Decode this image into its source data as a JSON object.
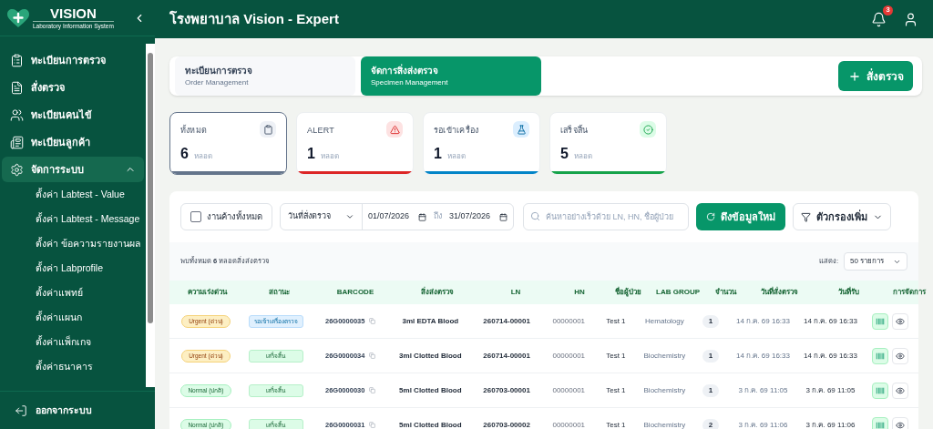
{
  "sidebar": {
    "logo": {
      "title": "VISION",
      "subtitle": "Laboratory Information System"
    },
    "items": [
      {
        "label": "ทะเบียนการตรวจ",
        "selected": false
      },
      {
        "label": "สั่งตรวจ",
        "selected": false
      },
      {
        "label": "ทะเบียนคนไข้",
        "selected": false
      },
      {
        "label": "ทะเบียนลูกค้า",
        "selected": false
      },
      {
        "label": "จัดการระบบ",
        "selected": true,
        "expanded": true,
        "children": [
          {
            "label": "ตั้งค่า Labtest - Value"
          },
          {
            "label": "ตั้งค่า Labtest - Message"
          },
          {
            "label": "ตั้งค่า ข้อความรายงานผล"
          },
          {
            "label": "ตั้งค่า Labprofile"
          },
          {
            "label": "ตั้งค่าแพทย์"
          },
          {
            "label": "ตั้งค่าแผนก"
          },
          {
            "label": "ตั้งค่าแพ็กเกจ"
          },
          {
            "label": "ตั้งค่าธนาคาร"
          }
        ]
      }
    ],
    "logout": "ออกจากระบบ"
  },
  "header": {
    "title": "โรงพยาบาล Vision - Expert",
    "notification_count": "3"
  },
  "tabs": [
    {
      "title": "ทะเบียนการตรวจ",
      "subtitle": "Order Management",
      "selected": false
    },
    {
      "title": "จัดการสิ่งส่งตรวจ",
      "subtitle": "Specimen Management",
      "selected": true
    }
  ],
  "new_order_button": "สั่งตรวจ",
  "stats": [
    {
      "label": "ทั้งหมด",
      "value": "6",
      "unit": "หลอด",
      "color": "#64748b",
      "selected": true
    },
    {
      "label": "ALERT",
      "value": "1",
      "unit": "หลอด",
      "color": "#dc2626",
      "selected": false
    },
    {
      "label": "รอเข้าเครื่อง",
      "value": "1",
      "unit": "หลอด",
      "color": "#0284c7",
      "selected": false
    },
    {
      "label": "เสร็จสิ้น",
      "value": "5",
      "unit": "หลอด",
      "color": "#16a34a",
      "selected": false
    }
  ],
  "filters": {
    "pending_all": {
      "label": "งานค้างทั้งหมด",
      "checked": false
    },
    "date_type": "วันที่สั่งตรวจ",
    "date_from": "01/07/2026",
    "date_sep": "ถึง",
    "date_to": "31/07/2026",
    "search": {
      "placeholder": "ค้นหาอย่างเร็วด้วย LN, HN, ชื่อผู้ป่วย"
    },
    "refresh_button": "ดึงข้อมูลใหม่",
    "more_filters_button": "ตัวกรองเพิ่ม"
  },
  "summary": "พบทั้งหมด **6** หลอดสิ่งส่งตรวจ",
  "page_size": {
    "label": "แสดง:",
    "value": "50 รายการ"
  },
  "table": {
    "columns": [
      "ความเร่งด่วน",
      "สถานะ",
      "BARCODE",
      "สิ่งส่งตรวจ",
      "LN",
      "HN",
      "ชื่อผู้ป่วย",
      "LAB GROUP",
      "จำนวน",
      "วันที่สั่งตรวจ",
      "วันที่รับ",
      "การจัดการ"
    ],
    "rows": [
      {
        "priority": {
          "kind": "urgent",
          "label": "Urgent (ด่วน)"
        },
        "status": {
          "kind": "waiting",
          "label": "รอเข้าเครื่องตรวจ"
        },
        "barcode": "26G0000035",
        "specimen": "3ml EDTA Blood",
        "ln": "260714-00001",
        "hn": "00000001",
        "patient": "Test 1",
        "lab_group": "Hematology",
        "count": "1",
        "ordered": "14 ก.ค. 69 16:33",
        "received": "14 ก.ค. 69 16:33"
      },
      {
        "priority": {
          "kind": "urgent",
          "label": "Urgent (ด่วน)"
        },
        "status": {
          "kind": "done",
          "label": "เสร็จสิ้น"
        },
        "barcode": "26G0000034",
        "specimen": "3ml Clotted Blood",
        "ln": "260714-00001",
        "hn": "00000001",
        "patient": "Test 1",
        "lab_group": "Biochemistry",
        "count": "1",
        "ordered": "14 ก.ค. 69 16:33",
        "received": "14 ก.ค. 69 16:33"
      },
      {
        "priority": {
          "kind": "normal",
          "label": "Normal (ปกติ)"
        },
        "status": {
          "kind": "done",
          "label": "เสร็จสิ้น"
        },
        "barcode": "26G0000030",
        "specimen": "5ml Clotted Blood",
        "ln": "260703-00001",
        "hn": "00000001",
        "patient": "Test 1",
        "lab_group": "Biochemistry",
        "count": "1",
        "ordered": "3 ก.ค. 69 11:05",
        "received": "3 ก.ค. 69 11:05"
      },
      {
        "priority": {
          "kind": "normal",
          "label": "Normal (ปกติ)"
        },
        "status": {
          "kind": "done",
          "label": "เสร็จสิ้น"
        },
        "barcode": "26G0000031",
        "specimen": "5ml Clotted Blood",
        "ln": "260703-00002",
        "hn": "00000001",
        "patient": "Test 1",
        "lab_group": "Biochemistry",
        "count": "2",
        "ordered": "3 ก.ค. 69 11:06",
        "received": "3 ก.ค. 69 11:06"
      }
    ]
  }
}
